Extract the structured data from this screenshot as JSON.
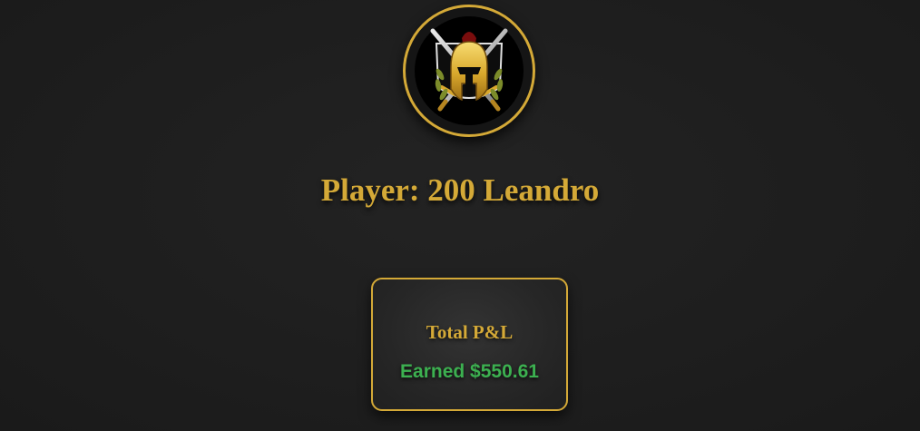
{
  "header": {
    "emblem_icon": "spartan-helmet-crossed-swords-icon",
    "player_title": "Player: 200 Leandro"
  },
  "pnl_card": {
    "label": "Total P&L",
    "value_text": "Earned $550.61",
    "value_color": "#3cb050"
  },
  "colors": {
    "accent_gold": "#d4a937",
    "background": "#1e1e1e",
    "positive_green": "#3cb050"
  }
}
